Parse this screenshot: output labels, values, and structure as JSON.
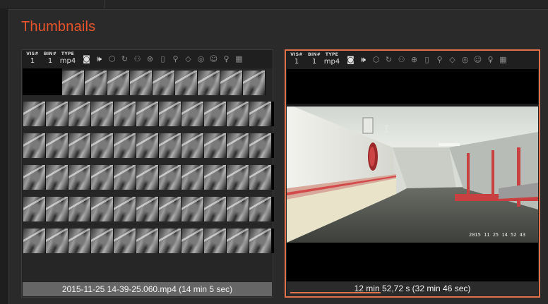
{
  "section_title": "Thumbnails",
  "cards": [
    {
      "meta": [
        {
          "key": "VIS#",
          "value": "1"
        },
        {
          "key": "BIN#",
          "value": "1"
        },
        {
          "key": "TYPE",
          "value": "mp4"
        }
      ],
      "caption": "2015-11-25 14-39-25.060.mp4 (14 min 5 sec)"
    },
    {
      "meta": [
        {
          "key": "VIS#",
          "value": "1"
        },
        {
          "key": "BIN#",
          "value": "1"
        },
        {
          "key": "TYPE",
          "value": "mp4"
        }
      ],
      "caption": "12 min 52,72 s (32 min 46 sec)",
      "video_timestamp": "2015 11 25 14 52 43",
      "playback_progress": 0.39
    }
  ],
  "toolbar_icons": [
    "camera-icon",
    "audio-icon",
    "hexagon-icon",
    "rotate-icon",
    "people-icon",
    "globe-icon",
    "bookmark-icon",
    "pin-icon",
    "tag-icon",
    "target-icon",
    "face-icon",
    "lightbulb-icon",
    "grid-icon"
  ],
  "colors": {
    "accent": "#e8542a",
    "selected_border": "#e0714a"
  }
}
